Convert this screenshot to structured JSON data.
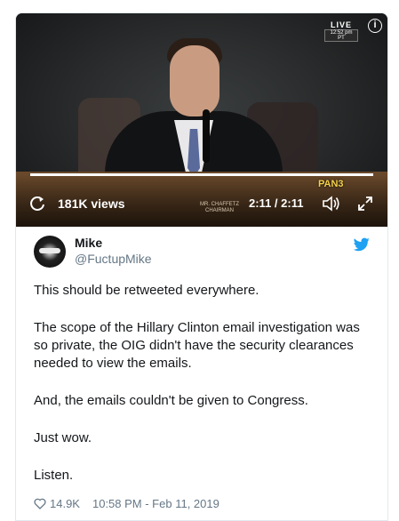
{
  "video": {
    "live_label": "LIVE",
    "live_time": "12:52 pm PT",
    "info_icon": "info-icon",
    "views": "181K views",
    "nameplate": "MR. CHAFFETZ\nCHAIRMAN",
    "time": "2:11 / 2:11",
    "logo": "PAN3",
    "progress": 1.0,
    "icons": [
      "replay-icon",
      "volume-icon",
      "expand-icon"
    ]
  },
  "tweet": {
    "display_name": "Mike",
    "handle": "@FuctupMike",
    "paragraphs": [
      "This should be retweeted everywhere.",
      "The scope of the Hillary Clinton email investigation was so private, the OIG didn't have the security clearances needed to view the emails.",
      "And, the emails couldn't be given to Congress.",
      "Just wow.",
      "Listen."
    ],
    "likes": "14.9K",
    "timestamp": "10:58 PM - Feb 11, 2019",
    "colors": {
      "twitter_blue": "#1da1f2",
      "muted": "#657786",
      "text": "#14171a"
    }
  }
}
